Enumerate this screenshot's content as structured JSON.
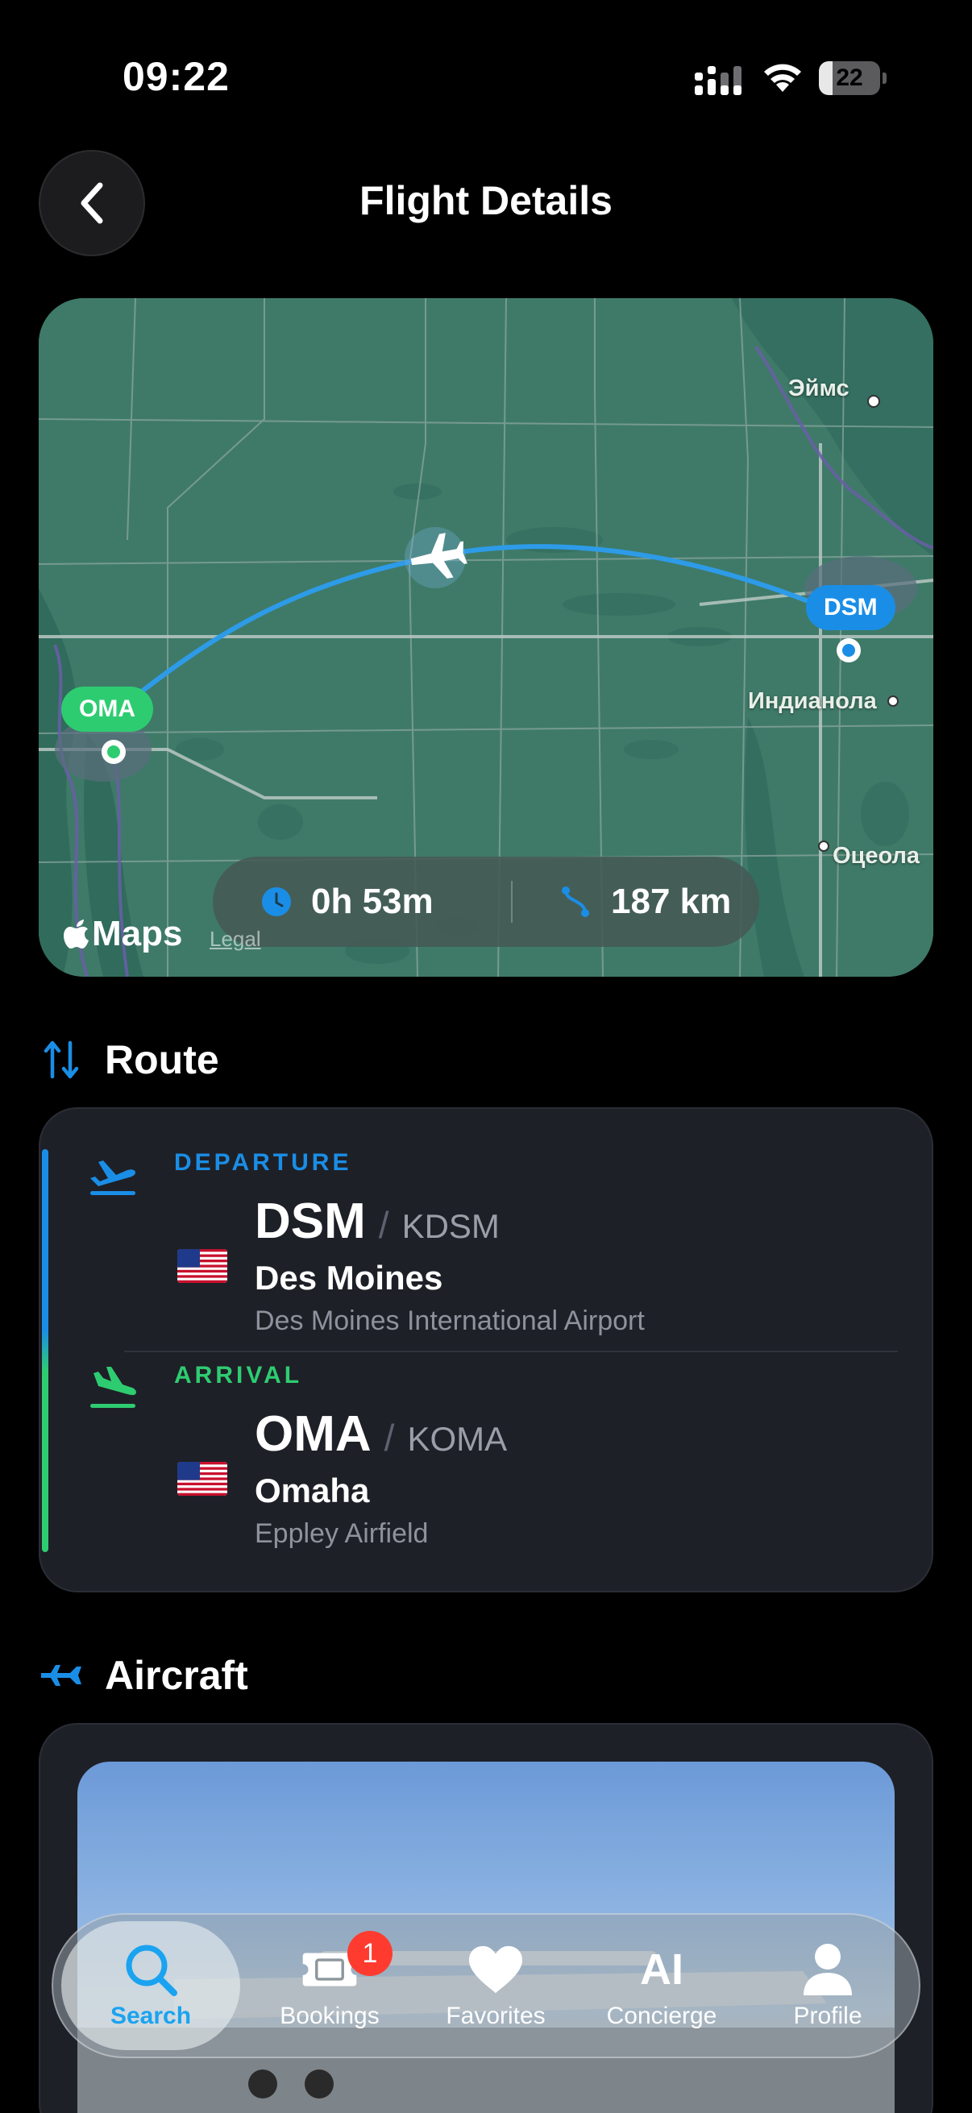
{
  "status_bar": {
    "time": "09:22",
    "battery_level": "22",
    "battery_fraction": 0.22
  },
  "nav": {
    "title": "Flight Details",
    "back_icon": "chevron-left-icon"
  },
  "map": {
    "places": {
      "ames": "Эймс",
      "indianola": "Индианола",
      "osceola": "Оцеола"
    },
    "origin_pin": "OMA",
    "destination_pin": "DSM",
    "duration": "0h 53m",
    "distance": "187 km",
    "maps_brand": "Maps",
    "legal": "Legal",
    "colors": {
      "land": "#3f7a68",
      "route": "#2d9be8",
      "oma": "#2ecc71",
      "dsm": "#1a8ee6"
    }
  },
  "route_section": {
    "title": "Route",
    "departure": {
      "label": "DEPARTURE",
      "code": "DSM",
      "icao": "KDSM",
      "city": "Des Moines",
      "airport": "Des Moines International Airport",
      "color": "#1a8ee6"
    },
    "arrival": {
      "label": "ARRIVAL",
      "code": "OMA",
      "icao": "KOMA",
      "city": "Omaha",
      "airport": "Eppley Airfield",
      "color": "#2ecc71"
    }
  },
  "aircraft_section": {
    "title": "Aircraft"
  },
  "tab_bar": {
    "tabs": [
      {
        "label": "Search",
        "icon": "search-icon",
        "active": true
      },
      {
        "label": "Bookings",
        "icon": "ticket-icon",
        "badge": "1"
      },
      {
        "label": "Favorites",
        "icon": "heart-icon"
      },
      {
        "label": "Concierge",
        "icon": "ai-icon",
        "glyph": "AI"
      },
      {
        "label": "Profile",
        "icon": "person-icon"
      }
    ]
  }
}
